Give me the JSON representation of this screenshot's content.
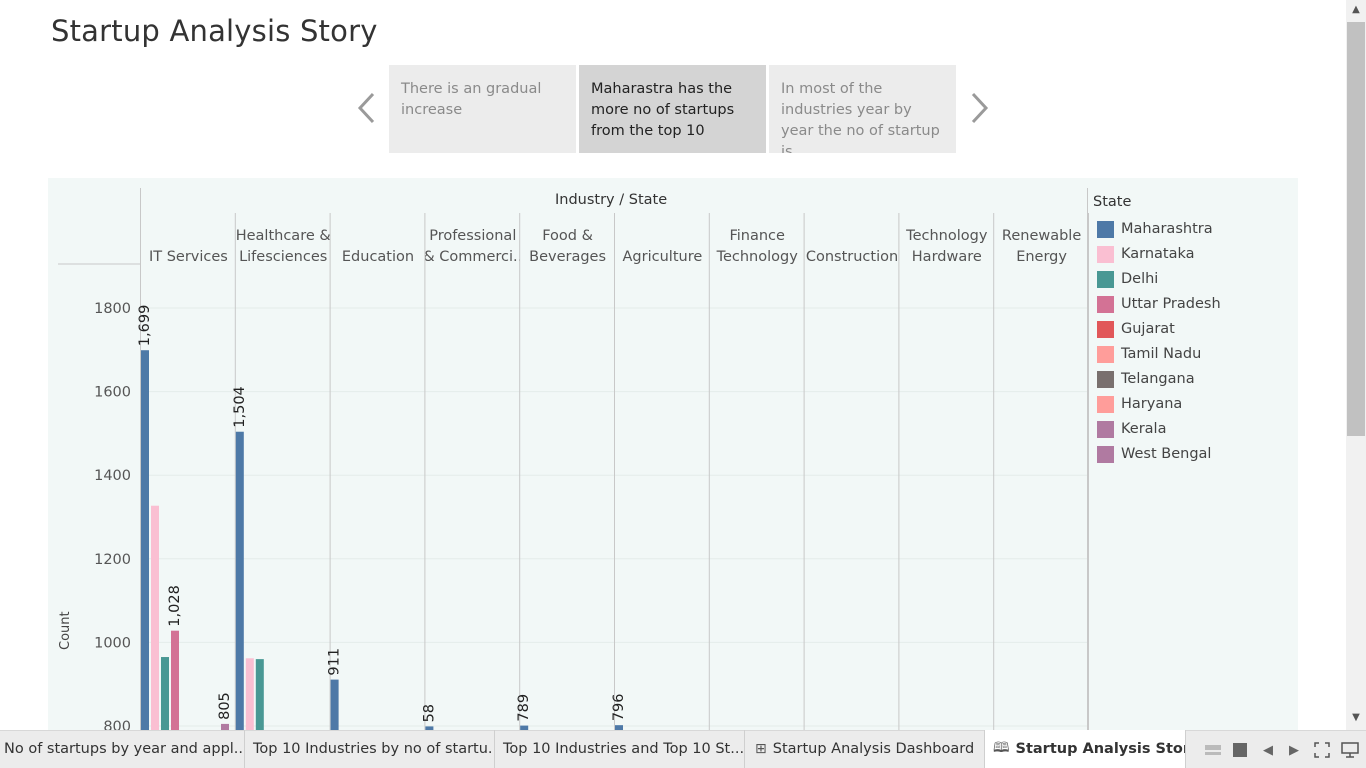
{
  "story": {
    "title": "Startup Analysis Story",
    "points": [
      {
        "text": "There is an gradual increase",
        "active": false
      },
      {
        "text": "Maharastra has the more no of startups from the top 10",
        "active": true
      },
      {
        "text": "In most of the industries year by year the  no of startup is",
        "active": false
      }
    ],
    "prev_icon": "chevron-left-icon",
    "next_icon": "chevron-right-icon"
  },
  "chart_data": {
    "type": "bar",
    "header_title": "Industry / State",
    "industries": [
      {
        "label": "IT Services"
      },
      {
        "label": "Healthcare & Lifesciences"
      },
      {
        "label": "Education"
      },
      {
        "label": "Professional & Commerci.."
      },
      {
        "label": "Food & Beverages"
      },
      {
        "label": "Agriculture"
      },
      {
        "label": "Finance Technology"
      },
      {
        "label": "Construction"
      },
      {
        "label": "Technology Hardware"
      },
      {
        "label": "Renewable Energy"
      }
    ],
    "states": [
      "Maharashtra",
      "Karnataka",
      "Delhi",
      "Uttar Pradesh",
      "Gujarat",
      "Tamil Nadu",
      "Telangana",
      "Haryana",
      "Kerala",
      "West Bengal"
    ],
    "colors": {
      "Maharashtra": "#4e79a7",
      "Karnataka": "#fabfd2",
      "Delhi": "#499894",
      "Uttar Pradesh": "#d37295",
      "Gujarat": "#e15759",
      "Tamil Nadu": "#ff9d9a",
      "Telangana": "#79706e",
      "Haryana": "#ff9d9a",
      "Kerala": "#b07aa1",
      "West Bengal": "#b07aa1"
    },
    "bars": [
      {
        "industry": "IT Services",
        "state": "Maharashtra",
        "value": 1699,
        "label": "1,699"
      },
      {
        "industry": "IT Services",
        "state": "Karnataka",
        "value": 1327,
        "label": ""
      },
      {
        "industry": "IT Services",
        "state": "Delhi",
        "value": 965,
        "label": ""
      },
      {
        "industry": "IT Services",
        "state": "Uttar Pradesh",
        "value": 1028,
        "label": "1,028"
      },
      {
        "industry": "IT Services",
        "state": "Kerala",
        "value": 805,
        "label": "805"
      },
      {
        "industry": "Healthcare & Lifesciences",
        "state": "Maharashtra",
        "value": 1504,
        "label": "1,504"
      },
      {
        "industry": "Healthcare & Lifesciences",
        "state": "Karnataka",
        "value": 962,
        "label": ""
      },
      {
        "industry": "Healthcare & Lifesciences",
        "state": "Delhi",
        "value": 960,
        "label": ""
      },
      {
        "industry": "Education",
        "state": "Maharashtra",
        "value": 911,
        "label": "911"
      },
      {
        "industry": "Professional & Commerci..",
        "state": "Maharashtra",
        "value": 799,
        "label": "58"
      },
      {
        "industry": "Food & Beverages",
        "state": "Maharashtra",
        "value": 801,
        "label": "789"
      },
      {
        "industry": "Agriculture",
        "state": "Maharashtra",
        "value": 802,
        "label": "796"
      }
    ],
    "y_axis": {
      "title": "Count",
      "ticks": [
        800,
        1000,
        1200,
        1400,
        1600,
        1800
      ],
      "visible_range": [
        796,
        1880
      ]
    },
    "legend": {
      "title": "State",
      "position": "right"
    },
    "grid": true
  },
  "tabs": [
    {
      "label": "No of startups by  year and appl...",
      "icon": "",
      "active": false
    },
    {
      "label": "Top 10 Industries by no of startu...",
      "icon": "",
      "active": false
    },
    {
      "label": "Top 10 Industries and Top 10 St...",
      "icon": "",
      "active": false
    },
    {
      "label": "Startup Analysis Dashboard",
      "icon": "dashboard-icon",
      "active": false
    },
    {
      "label": "Startup Analysis Story",
      "icon": "story-icon",
      "active": true
    }
  ],
  "toolbar_icons": [
    "show-tabs-icon",
    "show-filmstrip-icon",
    "previous-sheet-icon",
    "next-sheet-icon",
    "fit-icon",
    "present-mode-icon"
  ]
}
